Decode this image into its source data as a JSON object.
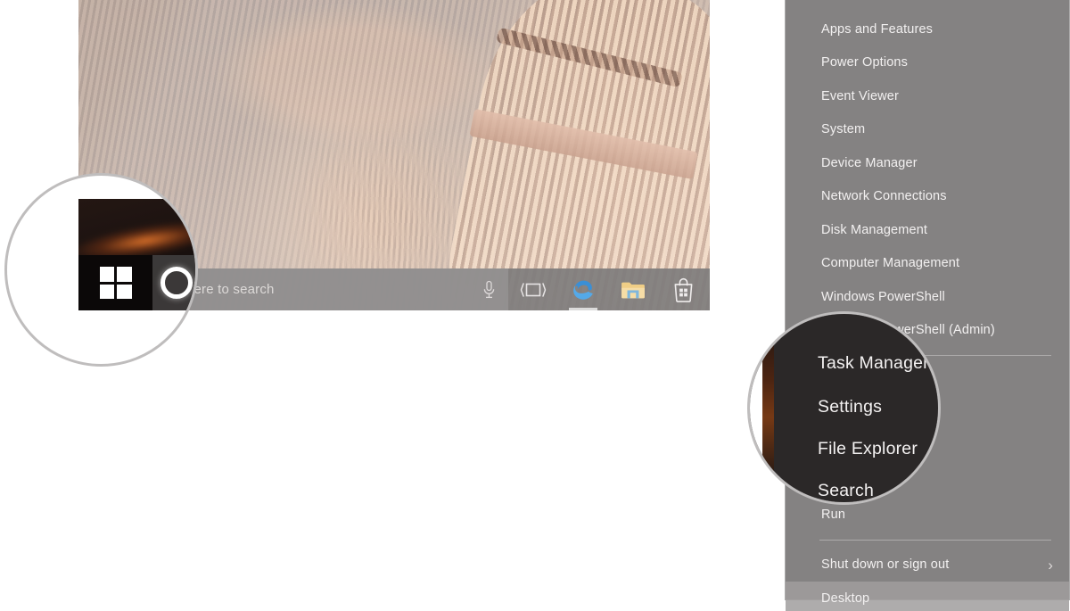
{
  "desktop": {
    "wallpaper_alt": "blurred warm-toned photo of bamboo brush bundles",
    "taskbar": {
      "start_button_label": "Start",
      "start_icon": "windows-logo-icon",
      "cortana_label": "Cortana",
      "cortana_icon": "cortana-circle-icon",
      "search_placeholder": "Type here to search",
      "search_visible_text": "e here to search",
      "mic_icon": "microphone-icon",
      "apps": [
        {
          "name": "task-view",
          "icon": "task-view-icon",
          "label": "Task View",
          "active": false
        },
        {
          "name": "microsoft-edge",
          "icon": "edge-icon",
          "label": "Microsoft Edge",
          "active": true
        },
        {
          "name": "file-explorer",
          "icon": "folder-icon",
          "label": "File Explorer",
          "active": false
        },
        {
          "name": "microsoft-store",
          "icon": "store-bag-icon",
          "label": "Microsoft Store",
          "active": false
        }
      ]
    }
  },
  "context_menu": {
    "title": "Start context menu",
    "items": [
      {
        "label": "Apps and Features",
        "name": "apps-and-features",
        "highlight": false,
        "submenu": false
      },
      {
        "label": "Power Options",
        "name": "power-options",
        "highlight": false,
        "submenu": false
      },
      {
        "label": "Event Viewer",
        "name": "event-viewer",
        "highlight": false,
        "submenu": false
      },
      {
        "label": "System",
        "name": "system",
        "highlight": false,
        "submenu": false
      },
      {
        "label": "Device Manager",
        "name": "device-manager",
        "highlight": false,
        "submenu": false
      },
      {
        "label": "Network Connections",
        "name": "network-connections",
        "highlight": false,
        "submenu": false
      },
      {
        "label": "Disk Management",
        "name": "disk-management",
        "highlight": false,
        "submenu": false
      },
      {
        "label": "Computer Management",
        "name": "computer-management",
        "highlight": false,
        "submenu": false
      },
      {
        "label": "Windows PowerShell",
        "name": "windows-powershell",
        "highlight": false,
        "submenu": false
      },
      {
        "label": "Windows PowerShell (Admin)",
        "name": "windows-powershell-admin",
        "highlight": false,
        "submenu": false
      },
      {
        "label": "Task Manager",
        "name": "task-manager",
        "highlight": false,
        "submenu": false
      },
      {
        "label": "Settings",
        "name": "settings",
        "highlight": false,
        "submenu": false
      },
      {
        "label": "File Explorer",
        "name": "file-explorer",
        "highlight": false,
        "submenu": false
      },
      {
        "label": "Search",
        "name": "search",
        "highlight": false,
        "submenu": false
      },
      {
        "label": "Run",
        "name": "run",
        "highlight": false,
        "submenu": false
      },
      {
        "label": "Shut down or sign out",
        "name": "shut-down-or-sign-out",
        "highlight": false,
        "submenu": true,
        "chevron": "›"
      },
      {
        "label": "Desktop",
        "name": "desktop",
        "highlight": true,
        "submenu": false
      }
    ]
  },
  "magnifiers": {
    "start": {
      "name": "start-button-magnifier",
      "highlights": "Start button and Cortana on the taskbar"
    },
    "menu": {
      "name": "menu-items-magnifier",
      "items": [
        "Task Manager",
        "Settings",
        "File Explorer",
        "Search"
      ]
    }
  },
  "colors": {
    "menu_background": "#807e7e",
    "menu_text": "#f2f0f0",
    "menu_highlight": "#a09e9e",
    "taskbar_background": "#7e7c7c",
    "start_button_background": "#121010",
    "magnifier_ring": "#bfbdbd",
    "magnifier_dark_fill": "#2b2828",
    "edge_blue": "#3b9ae1",
    "folder_yellow": "#f2d48a"
  }
}
